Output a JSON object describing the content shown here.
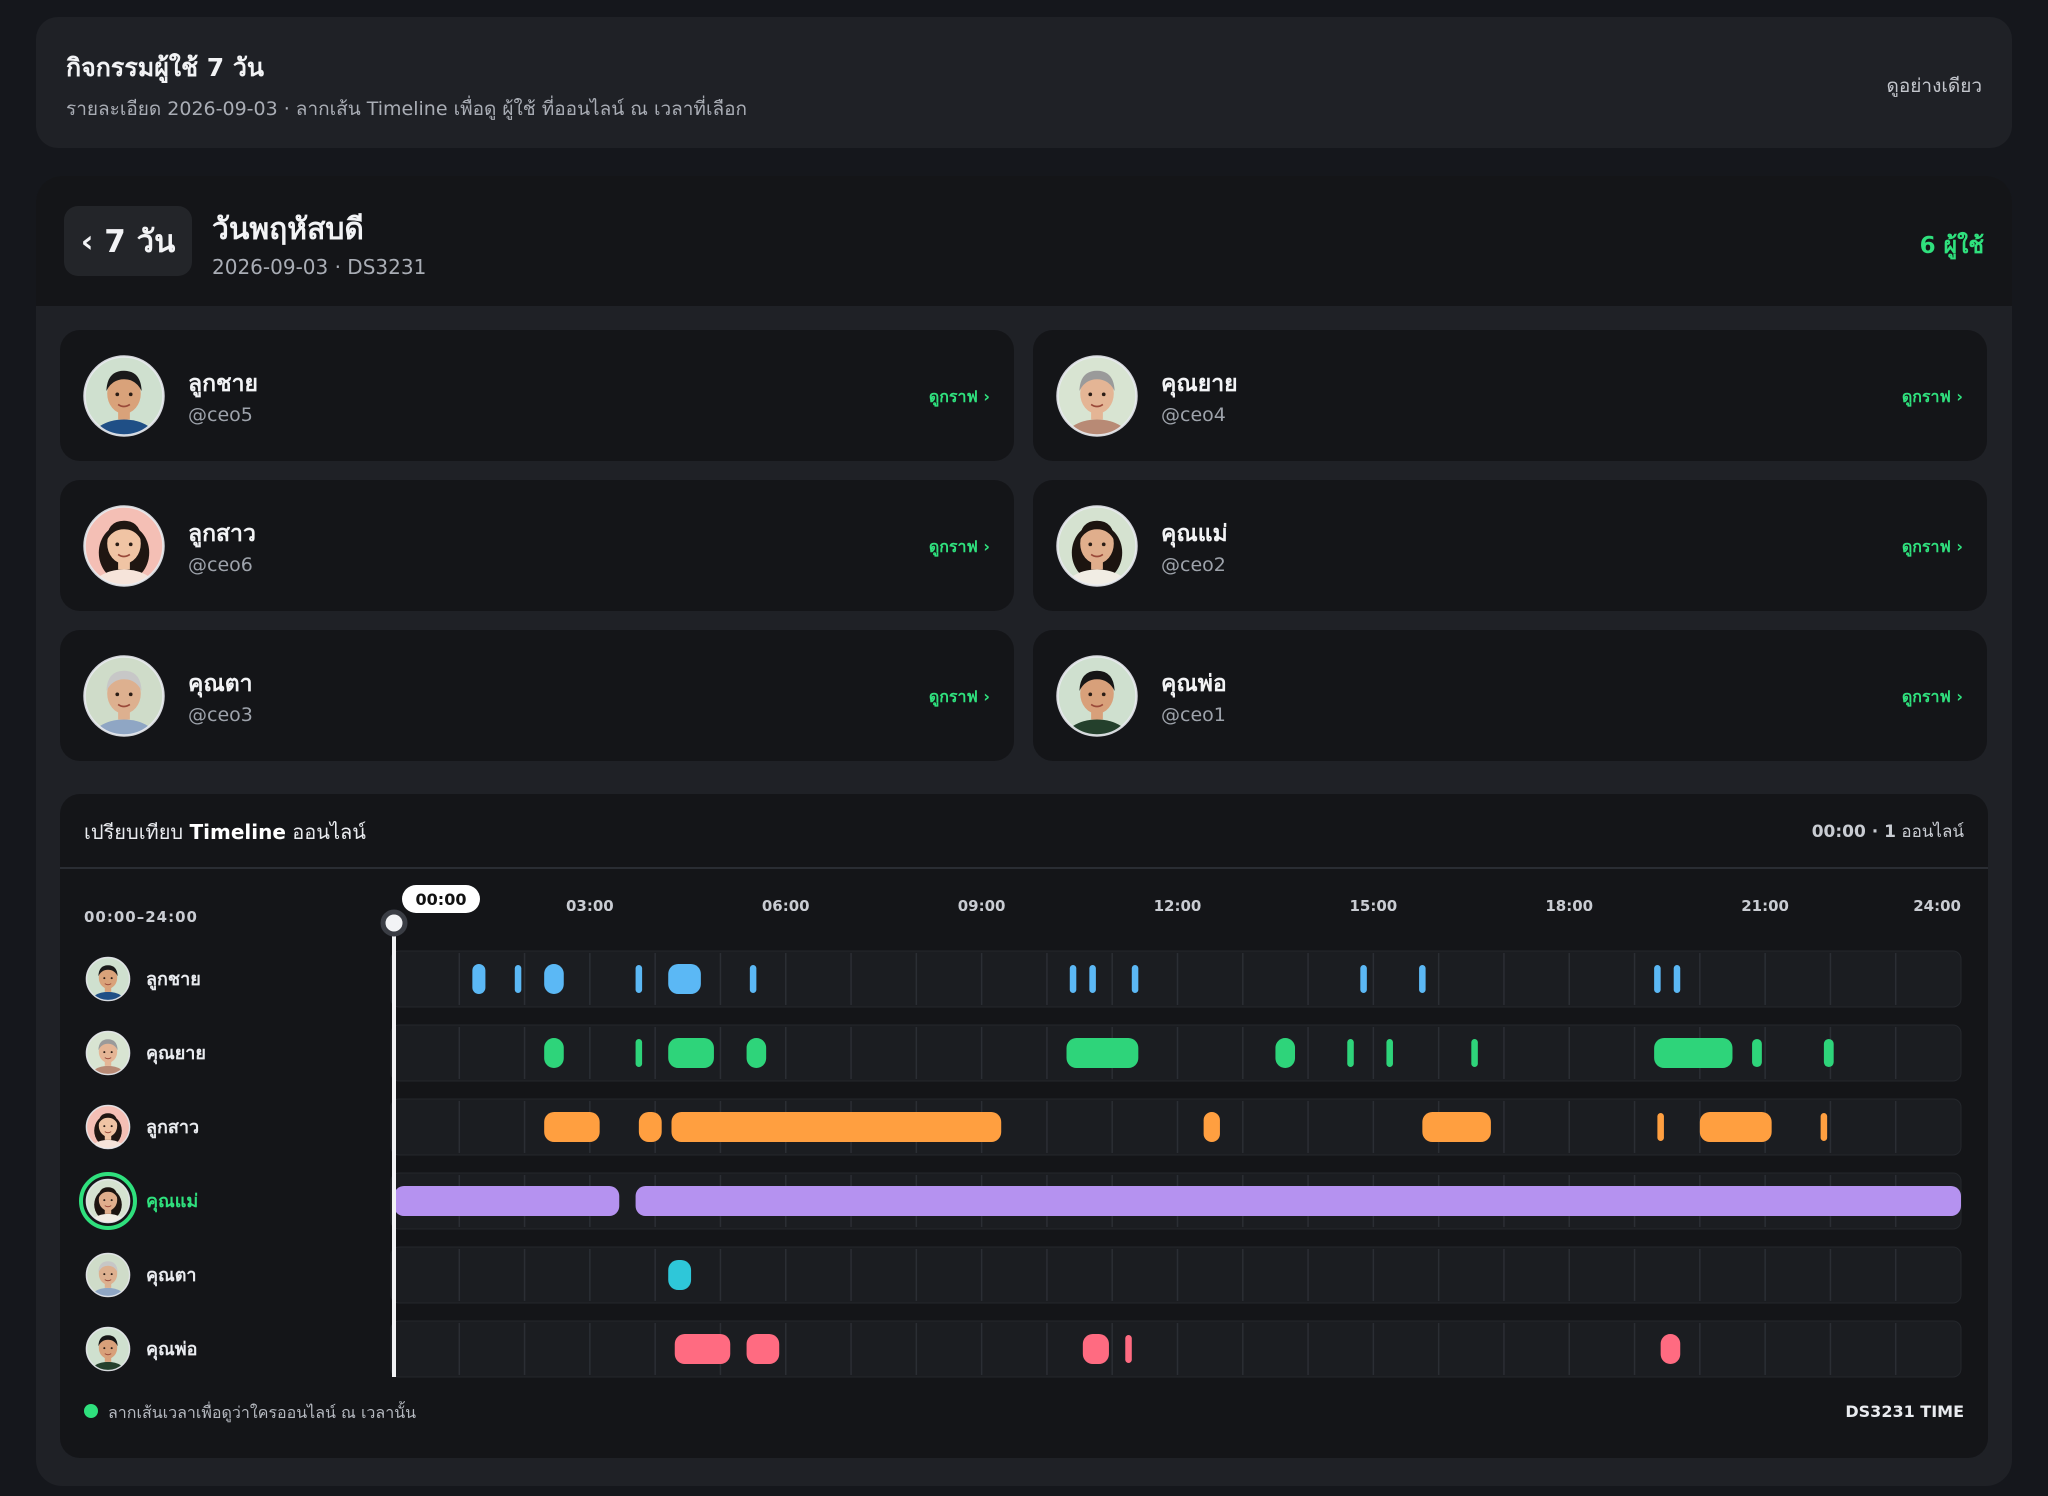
{
  "header": {
    "title": "กิจกรรมผู้ใช้ 7 วัน",
    "subtitle": "รายละเอียด 2026-09-03 · ลากเส้น Timeline เพื่อดู ผู้ใช้ ที่ออนไลน์ ณ เวลาที่เลือก",
    "mode_label": "ดูอย่างเดียว"
  },
  "day": {
    "back_label": "‹ 7 วัน",
    "title": "วันพฤหัสบดี",
    "subtitle": "2026-09-03 · DS3231",
    "users_count": "6 ผู้ใช้"
  },
  "link_label": "ดูกราฟ ›",
  "users": [
    {
      "name": "ลูกชาย",
      "handle": "@ceo5",
      "color": "#5bb8f5",
      "avatar_bg": "#cfe0cf",
      "skin": "#d9a27a",
      "hair": "#1a1a1a",
      "shirt": "#1f4f86",
      "long_hair": false,
      "grey": false
    },
    {
      "name": "คุณยาย",
      "handle": "@ceo4",
      "color": "#2ed47a",
      "avatar_bg": "#d8e4d2",
      "skin": "#e4b595",
      "hair": "#9a9a9a",
      "shirt": "#b88a75",
      "long_hair": false,
      "grey": true
    },
    {
      "name": "ลูกสาว",
      "handle": "@ceo6",
      "color": "#ff9f40",
      "avatar_bg": "#f4bfb5",
      "skin": "#f0c4a4",
      "hair": "#1f1612",
      "shirt": "#f6e4da",
      "long_hair": true,
      "grey": false
    },
    {
      "name": "คุณแม่",
      "handle": "@ceo2",
      "color": "#b592f0",
      "avatar_bg": "#d5e2d0",
      "skin": "#e0ae8c",
      "hair": "#1c1410",
      "shirt": "#f1ede4",
      "long_hair": true,
      "grey": false
    },
    {
      "name": "คุณตา",
      "handle": "@ceo3",
      "color": "#2ec7d9",
      "avatar_bg": "#cfdcc9",
      "skin": "#ddb08f",
      "hair": "#c7c7c7",
      "shirt": "#8fa6c4",
      "long_hair": false,
      "grey": true
    },
    {
      "name": "คุณพ่อ",
      "handle": "@ceo1",
      "color": "#ff6b81",
      "avatar_bg": "#cfe0cf",
      "skin": "#d8a07a",
      "hair": "#161616",
      "shirt": "#24402c",
      "long_hair": false,
      "grey": false
    }
  ],
  "timeline": {
    "title_prefix": "เปรียบเทียบ ",
    "title_bold": "Timeline",
    "title_suffix": " ออนไลน์",
    "status_time": "00:00 · 1",
    "status_suffix": " ออนไลน์",
    "range_label": "00:00–24:00",
    "scrubber_time": "00:00",
    "scrubber_hour": 0,
    "hour_ticks": [
      "03:00",
      "06:00",
      "09:00",
      "12:00",
      "15:00",
      "18:00",
      "21:00",
      "24:00"
    ],
    "active_row": "คุณแม่",
    "rows": [
      {
        "name": "ลูกชาย",
        "segments": [
          [
            1.2,
            1.4
          ],
          [
            1.85,
            1.95
          ],
          [
            2.3,
            2.6
          ],
          [
            3.7,
            3.8
          ],
          [
            4.2,
            4.7
          ],
          [
            5.45,
            5.55
          ],
          [
            10.35,
            10.45
          ],
          [
            10.65,
            10.75
          ],
          [
            11.3,
            11.4
          ],
          [
            14.8,
            14.9
          ],
          [
            15.7,
            15.8
          ],
          [
            19.3,
            19.4
          ],
          [
            19.6,
            19.7
          ]
        ]
      },
      {
        "name": "คุณยาย",
        "segments": [
          [
            2.3,
            2.6
          ],
          [
            3.7,
            3.8
          ],
          [
            4.2,
            4.9
          ],
          [
            5.4,
            5.7
          ],
          [
            10.3,
            11.4
          ],
          [
            13.5,
            13.8
          ],
          [
            14.6,
            14.7
          ],
          [
            15.2,
            15.3
          ],
          [
            16.5,
            16.6
          ],
          [
            19.3,
            20.5
          ],
          [
            20.8,
            20.95
          ],
          [
            21.9,
            22.05
          ]
        ]
      },
      {
        "name": "ลูกสาว",
        "segments": [
          [
            2.3,
            3.15
          ],
          [
            3.75,
            4.1
          ],
          [
            4.25,
            9.3
          ],
          [
            12.4,
            12.65
          ],
          [
            15.75,
            16.8
          ],
          [
            19.35,
            19.45
          ],
          [
            20.0,
            21.1
          ],
          [
            21.85,
            21.95
          ]
        ]
      },
      {
        "name": "คุณแม่",
        "segments": [
          [
            0.0,
            3.45
          ],
          [
            3.7,
            24.0
          ]
        ]
      },
      {
        "name": "คุณตา",
        "segments": [
          [
            4.2,
            4.55
          ]
        ]
      },
      {
        "name": "คุณพ่อ",
        "segments": [
          [
            4.3,
            5.15
          ],
          [
            5.4,
            5.9
          ],
          [
            10.55,
            10.95
          ],
          [
            11.2,
            11.3
          ],
          [
            19.4,
            19.7
          ]
        ]
      }
    ],
    "footer_text": "ลากเส้นเวลาเพื่อดูว่าใครออนไลน์ ณ เวลานั้น",
    "footer_right": "DS3231 TIME",
    "accent": "#2fe07d"
  }
}
